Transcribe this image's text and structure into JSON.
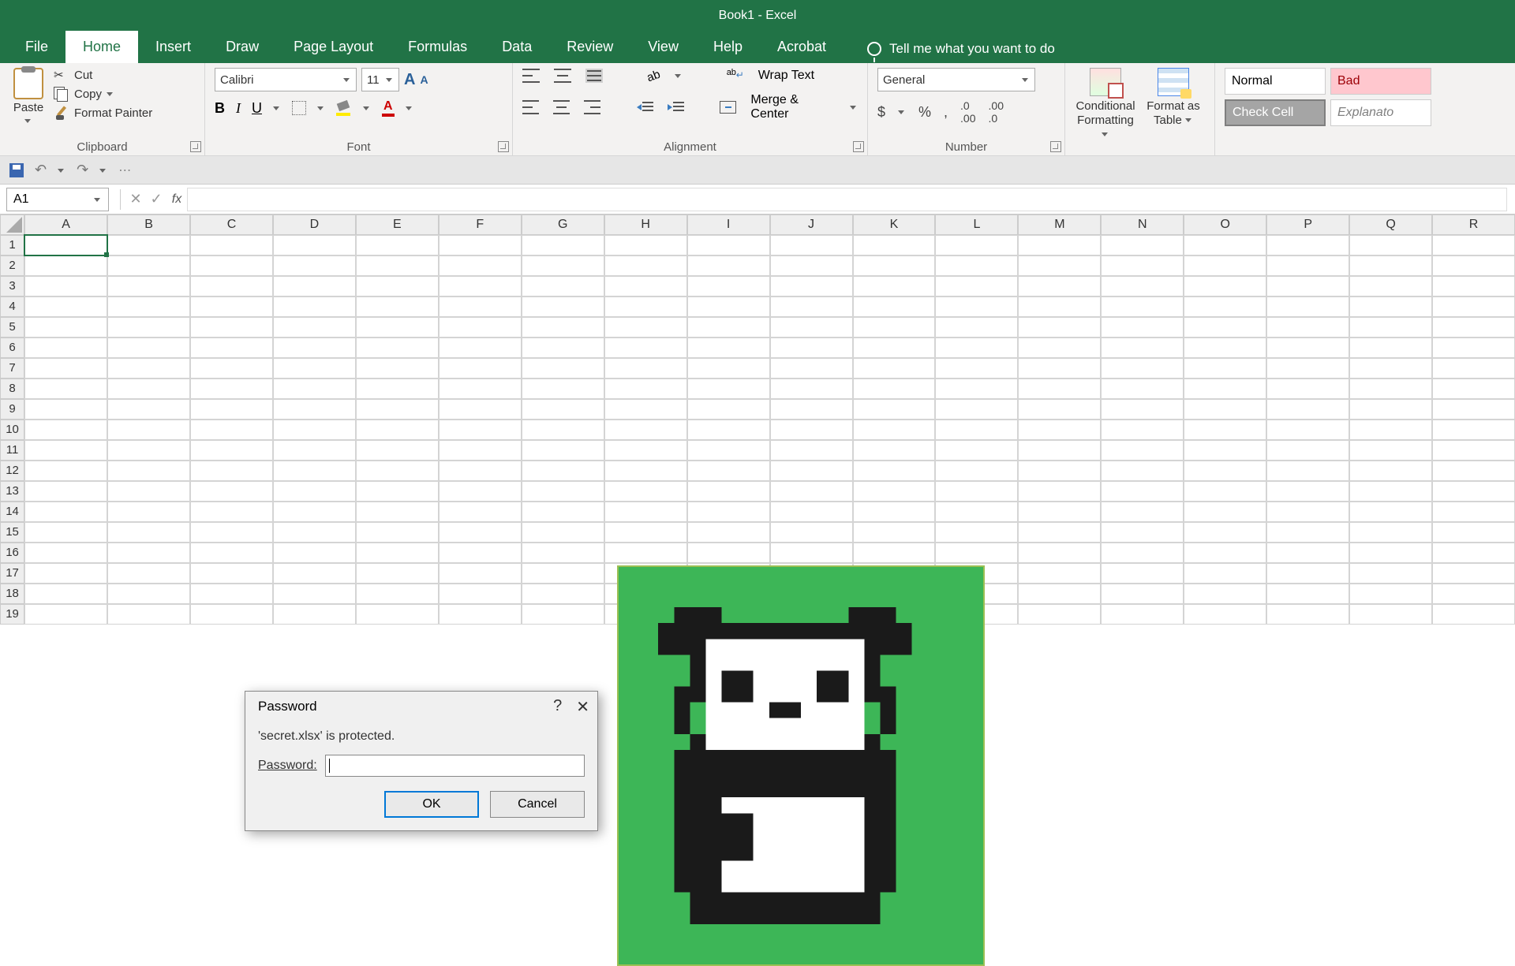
{
  "title": "Book1 - Excel",
  "tabs": [
    "File",
    "Home",
    "Insert",
    "Draw",
    "Page Layout",
    "Formulas",
    "Data",
    "Review",
    "View",
    "Help",
    "Acrobat"
  ],
  "active_tab": "Home",
  "tellme": "Tell me what you want to do",
  "ribbon": {
    "clipboard": {
      "label": "Clipboard",
      "paste": "Paste",
      "cut": "Cut",
      "copy": "Copy",
      "fp": "Format Painter"
    },
    "font": {
      "label": "Font",
      "name": "Calibri",
      "size": "11"
    },
    "alignment": {
      "label": "Alignment",
      "wrap": "Wrap Text",
      "merge": "Merge & Center"
    },
    "number": {
      "label": "Number",
      "format": "General"
    },
    "cf": "Conditional Formatting",
    "ft": "Format as Table",
    "styles": {
      "normal": "Normal",
      "bad": "Bad",
      "check": "Check Cell",
      "expl": "Explanato"
    }
  },
  "namebox": "A1",
  "columns": [
    "A",
    "B",
    "C",
    "D",
    "E",
    "F",
    "G",
    "H",
    "I",
    "J",
    "K",
    "L",
    "M",
    "N",
    "O",
    "P",
    "Q",
    "R"
  ],
  "rows_count": 19,
  "dialog": {
    "title": "Password",
    "msg": "'secret.xlsx' is protected.",
    "label": "Password:",
    "ok": "OK",
    "cancel": "Cancel"
  }
}
